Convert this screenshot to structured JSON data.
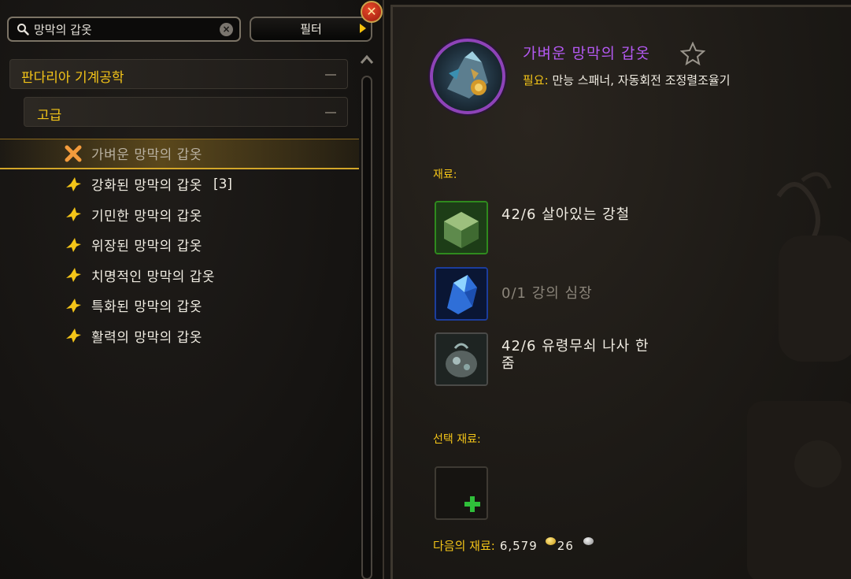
{
  "search": {
    "value": "망막의 갑옷"
  },
  "filter": {
    "label": "필터"
  },
  "categories": [
    {
      "label": "판다리아 기계공학"
    },
    {
      "label": "고급"
    }
  ],
  "recipes": [
    {
      "name": "가벼운 망막의 갑옷",
      "count": "",
      "selected": true
    },
    {
      "name": "강화된 망막의 갑옷",
      "count": "[3]"
    },
    {
      "name": "기민한 망막의 갑옷",
      "count": ""
    },
    {
      "name": "위장된 망막의 갑옷",
      "count": ""
    },
    {
      "name": "치명적인 망막의 갑옷",
      "count": ""
    },
    {
      "name": "특화된 망막의 갑옷",
      "count": ""
    },
    {
      "name": "활력의 망막의 갑옷",
      "count": ""
    }
  ],
  "detail": {
    "title": "가벼운 망막의 갑옷",
    "tools_label": "필요:",
    "tools_value": "만능 스패너, 자동회전 조정렬조율기",
    "reagents_label": "재료:",
    "reagents": [
      {
        "text": "42/6 살아있는 강철",
        "sufficient": true
      },
      {
        "text": "0/1 강의 심장",
        "sufficient": false
      },
      {
        "text": "42/6 유령무쇠 나사 한 줌",
        "sufficient": true
      }
    ],
    "optional_label": "선택 재료:",
    "next_label": "다음의 재료:",
    "next_gold": "6,579",
    "next_silver": "26"
  },
  "colors": {
    "accent_gold": "#f3c418",
    "title_purple": "#b459f2",
    "text": "#f0ece2",
    "lacking_text": "#8b857a"
  },
  "icons": {
    "search": "search-icon",
    "clear": "clear-icon",
    "filter_arrow": "arrow-right-icon",
    "close": "close-icon",
    "favorite": "star-outline-icon",
    "selected_recipe": "crossed-swords-icon",
    "recipe": "skill-up-icon",
    "add_optional": "plus-icon"
  }
}
